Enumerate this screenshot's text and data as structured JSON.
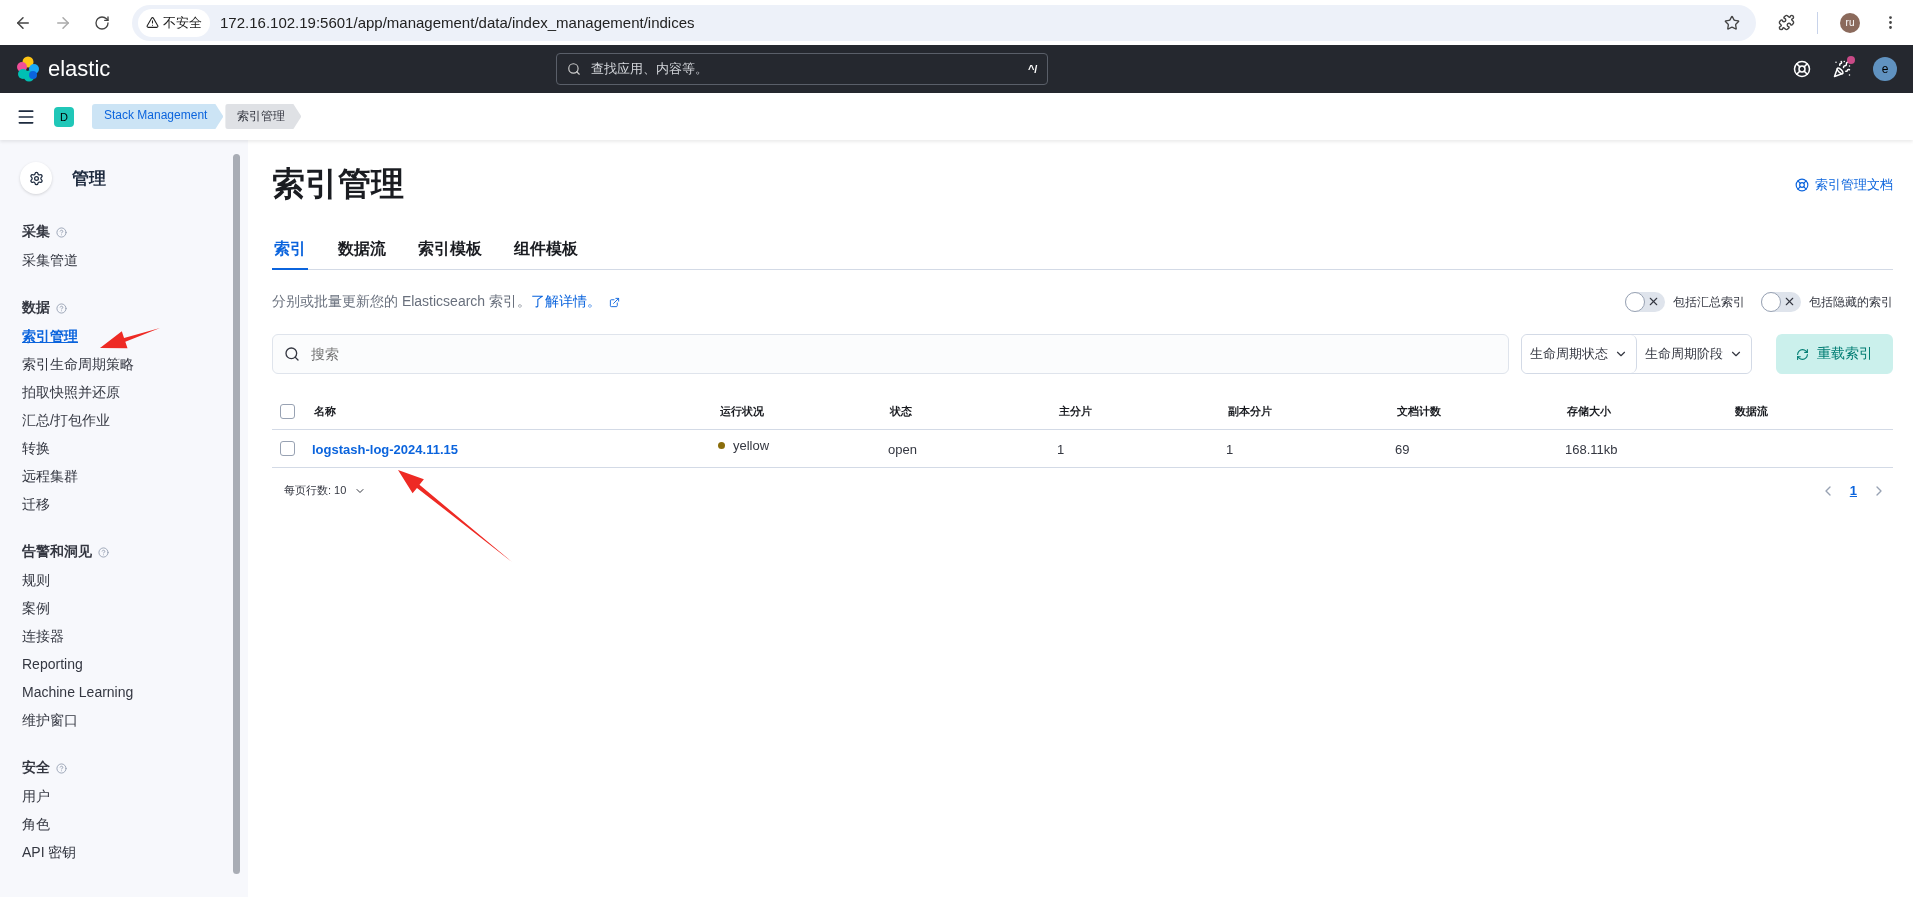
{
  "browser": {
    "security": "不安全",
    "address": "172.16.102.19:5601/app/management/data/index_management/indices",
    "profile": "ru"
  },
  "header": {
    "logo": "elastic",
    "search_placeholder": "查找应用、内容等。",
    "shortcut": "^/",
    "avatar": "e"
  },
  "breadcrumbs": {
    "space": "D",
    "items": [
      {
        "label": "Stack Management",
        "current": false
      },
      {
        "label": "索引管理",
        "current": true
      }
    ]
  },
  "sidebar": {
    "title": "管理",
    "groups": [
      {
        "title": "采集",
        "items": [
          {
            "label": "采集管道",
            "selected": false
          }
        ]
      },
      {
        "title": "数据",
        "items": [
          {
            "label": "索引管理",
            "selected": true
          },
          {
            "label": "索引生命周期策略",
            "selected": false
          },
          {
            "label": "拍取快照并还原",
            "selected": false
          },
          {
            "label": "汇总/打包作业",
            "selected": false
          },
          {
            "label": "转换",
            "selected": false
          },
          {
            "label": "远程集群",
            "selected": false
          },
          {
            "label": "迁移",
            "selected": false
          }
        ]
      },
      {
        "title": "告警和洞见",
        "items": [
          {
            "label": "规则",
            "selected": false
          },
          {
            "label": "案例",
            "selected": false
          },
          {
            "label": "连接器",
            "selected": false
          },
          {
            "label": "Reporting",
            "selected": false
          },
          {
            "label": "Machine Learning",
            "selected": false
          },
          {
            "label": "维护窗口",
            "selected": false
          }
        ]
      },
      {
        "title": "安全",
        "items": [
          {
            "label": "用户",
            "selected": false
          },
          {
            "label": "角色",
            "selected": false
          },
          {
            "label": "API 密钥",
            "selected": false
          }
        ]
      }
    ]
  },
  "page": {
    "title": "索引管理",
    "docs_link": "索引管理文档",
    "tabs": [
      {
        "label": "索引",
        "selected": true
      },
      {
        "label": "数据流",
        "selected": false
      },
      {
        "label": "索引模板",
        "selected": false
      },
      {
        "label": "组件模板",
        "selected": false
      }
    ],
    "description": "分别或批量更新您的 Elasticsearch 索引。",
    "learn_more": "了解详情。",
    "toggles": [
      {
        "label": "包括汇总索引",
        "on": false
      },
      {
        "label": "包括隐藏的索引",
        "on": false
      }
    ],
    "search_placeholder": "搜索",
    "filters": [
      "生命周期状态",
      "生命周期阶段"
    ],
    "reload_button": "重载索引",
    "table": {
      "select_all_checked": false,
      "columns": [
        "名称",
        "运行状况",
        "状态",
        "主分片",
        "副本分片",
        "文档计数",
        "存储大小",
        "数据流"
      ],
      "rows": [
        {
          "checked": false,
          "name": "logstash-log-2024.11.15",
          "health": "yellow",
          "color": "#8a6d0b",
          "status": "open",
          "primary": "1",
          "replicas": "1",
          "docs_count": "69",
          "storage_size": "168.11kb"
        }
      ]
    },
    "pagination": {
      "rows_per_page": "每页行数: 10",
      "pages": [
        {
          "label": "1",
          "selected": true
        }
      ]
    }
  }
}
